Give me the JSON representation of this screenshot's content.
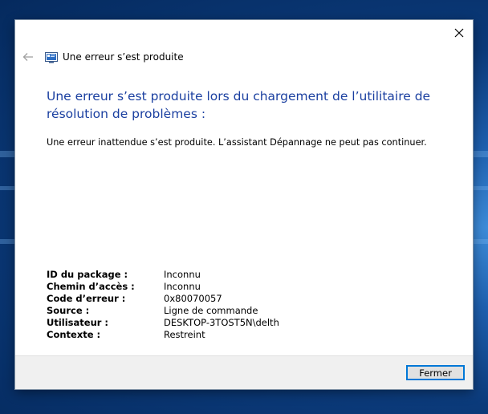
{
  "dialog": {
    "header_title": "Une erreur s’est produite",
    "heading": "Une erreur s’est produite lors du chargement de l’utilitaire de résolution de problèmes :",
    "message": "Une erreur inattendue s’est produite. L’assistant Dépannage ne peut pas continuer.",
    "details": [
      {
        "label": "ID du package :",
        "value": "Inconnu"
      },
      {
        "label": "Chemin d’accès :",
        "value": "Inconnu"
      },
      {
        "label": "Code d’erreur :",
        "value": "0x80070057"
      },
      {
        "label": "Source :",
        "value": "Ligne de commande"
      },
      {
        "label": "Utilisateur :",
        "value": "DESKTOP-3TOST5N\\delth"
      },
      {
        "label": "Contexte :",
        "value": "Restreint"
      }
    ],
    "close_button_label": "Fermer"
  },
  "icons": {
    "close": "close-icon",
    "back": "back-arrow-icon",
    "app": "troubleshooter-icon"
  },
  "colors": {
    "heading": "#1a3fa0",
    "button_border": "#0078d7",
    "footer_bg": "#f0f0f0"
  }
}
